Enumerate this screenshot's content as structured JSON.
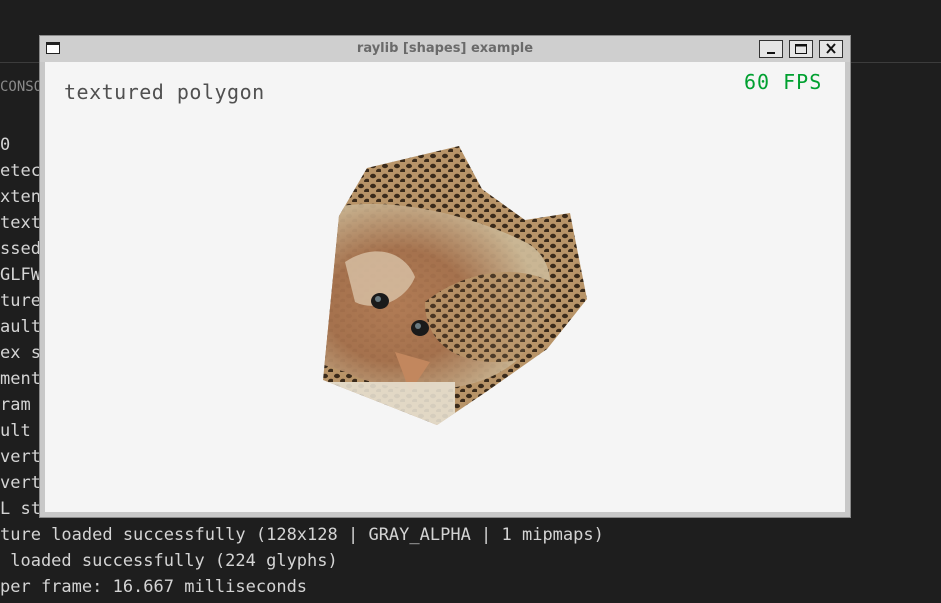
{
  "console": {
    "tab_label": "CONSO",
    "lines": [
      "0",
      "etec",
      "xten",
      "text",
      "ssed",
      "GLFW",
      "ture",
      "ault",
      "ex s",
      "ment",
      "ram ",
      "ult ",
      "vert",
      "vert",
      "L st",
      "ture loaded successfully (128x128 | GRAY_ALPHA | 1 mipmaps)",
      " loaded successfully (224 glyphs)",
      "per frame: 16.667 milliseconds"
    ]
  },
  "window": {
    "title": "raylib [shapes] example",
    "buttons": {
      "minimize": "minimize",
      "maximize": "maximize",
      "close": "close"
    },
    "canvas": {
      "label": "textured polygon",
      "fps": "60 FPS"
    }
  },
  "colors": {
    "fps": "#00a030",
    "label": "#505050",
    "background": "#f5f5f5"
  }
}
